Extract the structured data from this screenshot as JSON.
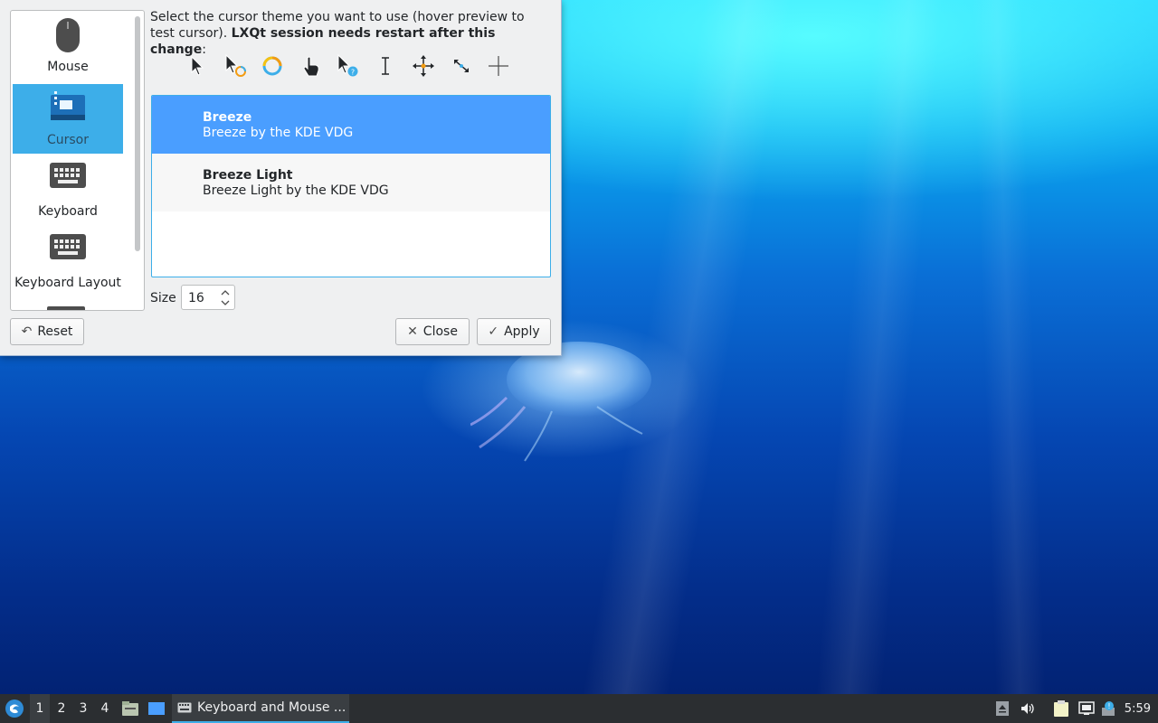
{
  "window": {
    "sidebar": {
      "items": [
        {
          "label": "Mouse",
          "icon": "mouse-icon"
        },
        {
          "label": "Cursor",
          "icon": "cursor-settings-icon",
          "selected": true
        },
        {
          "label": "Keyboard",
          "icon": "keyboard-icon"
        },
        {
          "label": "Keyboard Layout",
          "icon": "keyboard-layout-icon"
        }
      ]
    },
    "description_plain": "Select the cursor theme you want to use (hover preview to test cursor). ",
    "description_bold": "LXQt session needs restart after this change",
    "description_suffix": ":",
    "preview_cursors": [
      "arrow-cursor-icon",
      "busy-arrow-cursor-icon",
      "wait-spinner-cursor-icon",
      "hand-cursor-icon",
      "help-cursor-icon",
      "text-beam-cursor-icon",
      "move-cursor-icon",
      "resize-diagonal-cursor-icon",
      "crosshair-cursor-icon"
    ],
    "themes": [
      {
        "name": "Breeze",
        "description": "Breeze by the KDE VDG",
        "selected": true
      },
      {
        "name": "Breeze Light",
        "description": "Breeze Light by the KDE VDG",
        "selected": false
      }
    ],
    "size_label": "Size",
    "size_value": "16",
    "buttons": {
      "reset": "Reset",
      "close": "Close",
      "apply": "Apply"
    }
  },
  "taskbar": {
    "workspaces": [
      "1",
      "2",
      "3",
      "4"
    ],
    "active_workspace": "1",
    "task_label": "Keyboard and Mouse ...",
    "clock": "5:59"
  },
  "colors": {
    "accent": "#3daee9",
    "selection": "#4a9eff",
    "taskbar": "#2b2e31"
  }
}
